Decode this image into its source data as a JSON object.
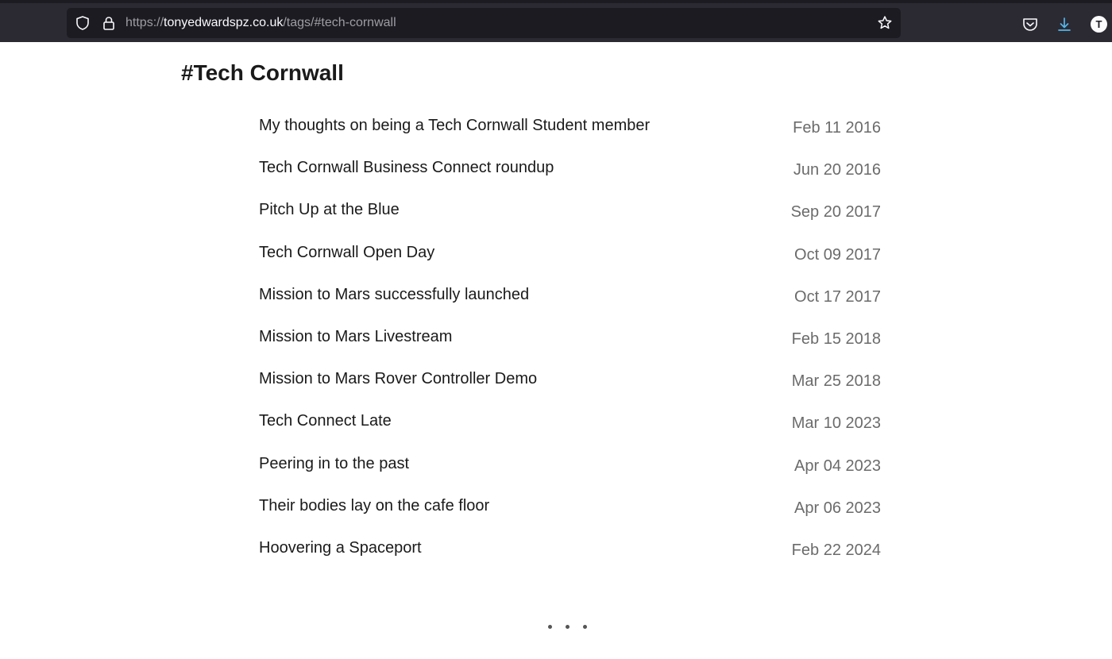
{
  "browser": {
    "url_scheme": "https://",
    "url_host": "tonyedwardspz.co.uk",
    "url_path": "/tags/#tech-cornwall",
    "avatar_letter": "T",
    "icons": [
      "shield-icon",
      "lock-icon",
      "bookmark-star-icon",
      "pocket-icon",
      "download-icon",
      "account-avatar"
    ],
    "colors": {
      "toolbar": "#2b2a33",
      "url_field": "#1c1b22",
      "download_accent": "#54b6e8"
    }
  },
  "page": {
    "title": "#Tech Cornwall",
    "posts": [
      {
        "title": "My thoughts on being a Tech Cornwall Student member",
        "date": "Feb 11 2016"
      },
      {
        "title": "Tech Cornwall Business Connect roundup",
        "date": "Jun 20 2016"
      },
      {
        "title": "Pitch Up at the Blue",
        "date": "Sep 20 2017"
      },
      {
        "title": "Tech Cornwall Open Day",
        "date": "Oct 09 2017"
      },
      {
        "title": "Mission to Mars successfully launched",
        "date": "Oct 17 2017"
      },
      {
        "title": "Mission to Mars Livestream",
        "date": "Feb 15 2018"
      },
      {
        "title": "Mission to Mars Rover Controller Demo",
        "date": "Mar 25 2018"
      },
      {
        "title": "Tech Connect Late",
        "date": "Mar 10 2023"
      },
      {
        "title": "Peering in to the past",
        "date": "Apr 04 2023"
      },
      {
        "title": "Their bodies lay on the cafe floor",
        "date": "Apr 06 2023"
      },
      {
        "title": "Hoovering a Spaceport",
        "date": "Feb 22 2024"
      }
    ],
    "pager_icon": "ellipsis-icon"
  }
}
